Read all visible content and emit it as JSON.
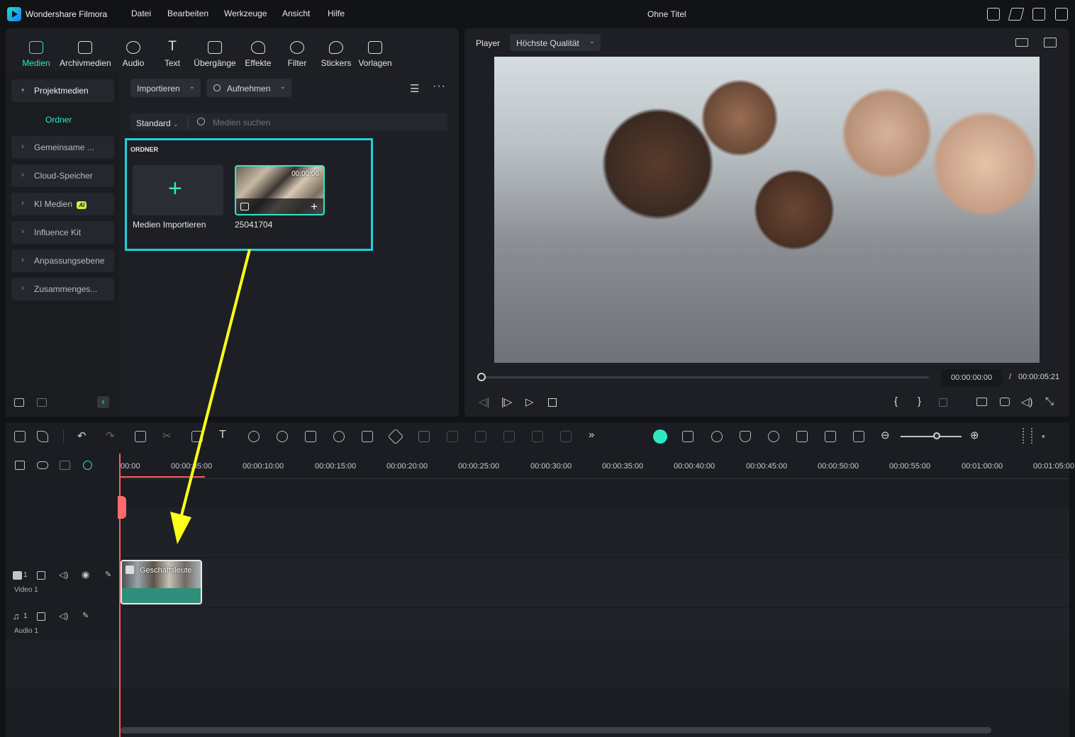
{
  "app": {
    "name": "Wondershare Filmora",
    "window_title": "Ohne Titel",
    "menu": [
      "Datei",
      "Bearbeiten",
      "Werkzeuge",
      "Ansicht",
      "Hilfe"
    ]
  },
  "media_tabs": [
    "Medien",
    "Archivmedien",
    "Audio",
    "Text",
    "Übergänge",
    "Effekte",
    "Filter",
    "Stickers",
    "Vorlagen"
  ],
  "sidebar": {
    "project_media": "Projektmedien",
    "folder": "Ordner",
    "items": [
      "Gemeinsame ...",
      "Cloud-Speicher",
      "KI Medien",
      "Influence Kit",
      "Anpassungsebene",
      "Zusammenges..."
    ],
    "ai_badge": "AI"
  },
  "media_toolbar": {
    "import": "Importieren",
    "record": "Aufnehmen",
    "sort": "Standard",
    "search_placeholder": "Medien suchen"
  },
  "media_grid": {
    "section": "ORDNER",
    "import_label": "Medien Importieren",
    "clip_name": "25041704",
    "clip_duration": "00:00:06"
  },
  "player": {
    "label": "Player",
    "quality": "Höchste Qualität",
    "current_time": "00:00:00:00",
    "separator": "/",
    "total_time": "00:00:05:21"
  },
  "timeline": {
    "ruler": [
      "00:00",
      "00:00:05:00",
      "00:00:10:00",
      "00:00:15:00",
      "00:00:20:00",
      "00:00:25:00",
      "00:00:30:00",
      "00:00:35:00",
      "00:00:40:00",
      "00:00:45:00",
      "00:00:50:00",
      "00:00:55:00",
      "00:01:00:00",
      "00:01:05:00"
    ],
    "video_track": "Video 1",
    "audio_track": "Audio 1",
    "track_number": "1",
    "clip_title": "Geschäftsleute"
  },
  "colors": {
    "accent": "#2ee8c4",
    "highlight": "#20d0d8",
    "arrow": "#ffff1a",
    "playhead": "#ff5a5a"
  }
}
